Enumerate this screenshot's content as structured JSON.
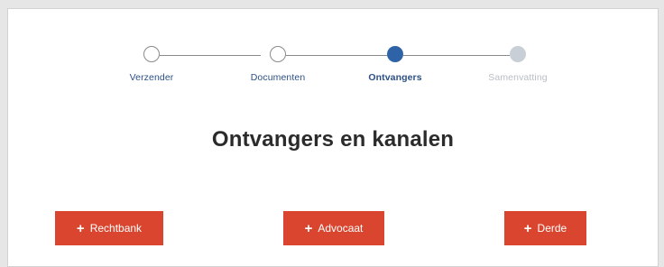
{
  "stepper": {
    "steps": [
      {
        "label": "Verzender",
        "state": "completed"
      },
      {
        "label": "Documenten",
        "state": "completed"
      },
      {
        "label": "Ontvangers",
        "state": "active"
      },
      {
        "label": "Samenvatting",
        "state": "upcoming"
      }
    ]
  },
  "main": {
    "title": "Ontvangers en kanalen"
  },
  "actions": {
    "rechtbank_label": "Rechtbank",
    "advocaat_label": "Advocaat",
    "derde_label": "Derde",
    "plus_icon": "plus-icon"
  },
  "colors": {
    "accent": "#d9452e",
    "active_step": "#2f63a8",
    "upcoming_step": "#c9cfd6",
    "completed_step_border": "#8a8a8a",
    "step_label": "#2c4f86",
    "upcoming_label": "#b9bec4"
  }
}
